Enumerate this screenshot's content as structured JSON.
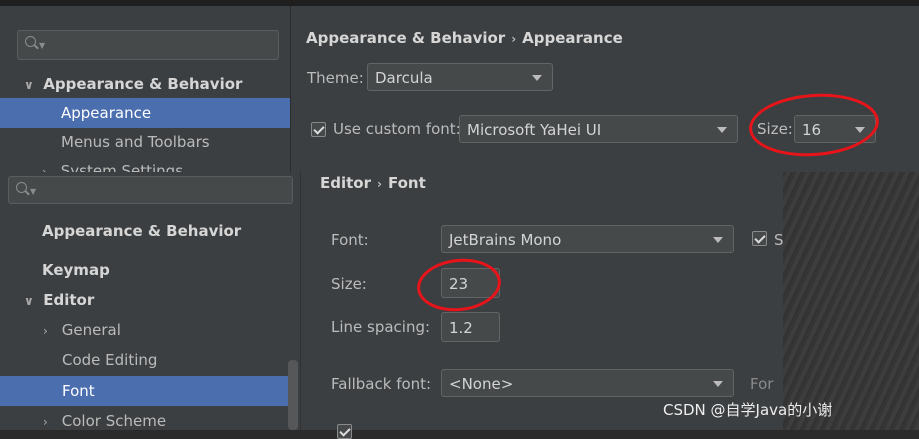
{
  "top_dialog": {
    "search": {
      "placeholder": ""
    },
    "sidebar": {
      "group": "Appearance & Behavior",
      "items": [
        {
          "label": "Appearance"
        },
        {
          "label": "Menus and Toolbars"
        },
        {
          "label": "System Settings"
        }
      ]
    },
    "breadcrumb": {
      "part1": "Appearance & Behavior",
      "sep": "›",
      "part2": "Appearance"
    },
    "theme": {
      "label": "Theme:",
      "value": "Darcula"
    },
    "custom_font": {
      "checkbox_label": "Use custom font:",
      "checked": true,
      "value": "Microsoft YaHei UI"
    },
    "size": {
      "label": "Size:",
      "value": "16"
    }
  },
  "bottom_dialog": {
    "search": {
      "placeholder": ""
    },
    "sidebar": {
      "items": [
        {
          "label": "Appearance & Behavior"
        },
        {
          "label": "Keymap"
        },
        {
          "label": "Editor"
        },
        {
          "label": "General"
        },
        {
          "label": "Code Editing"
        },
        {
          "label": "Font"
        },
        {
          "label": "Color Scheme"
        }
      ]
    },
    "breadcrumb": {
      "part1": "Editor",
      "sep": "›",
      "part2": "Font"
    },
    "font": {
      "label": "Font:",
      "value": "JetBrains Mono",
      "extra_checkbox_label": "S",
      "checked": true
    },
    "size": {
      "label": "Size:",
      "value": "23"
    },
    "line_spacing": {
      "label": "Line spacing:",
      "value": "1.2"
    },
    "fallback_font": {
      "label": "Fallback font:",
      "value": "<None>",
      "extra_label": "For"
    }
  },
  "watermark": "CSDN @自学Java的小谢",
  "colors": {
    "selection": "#4b6eaf",
    "background": "#3c3f41",
    "annotation_red": "#e8141a"
  }
}
